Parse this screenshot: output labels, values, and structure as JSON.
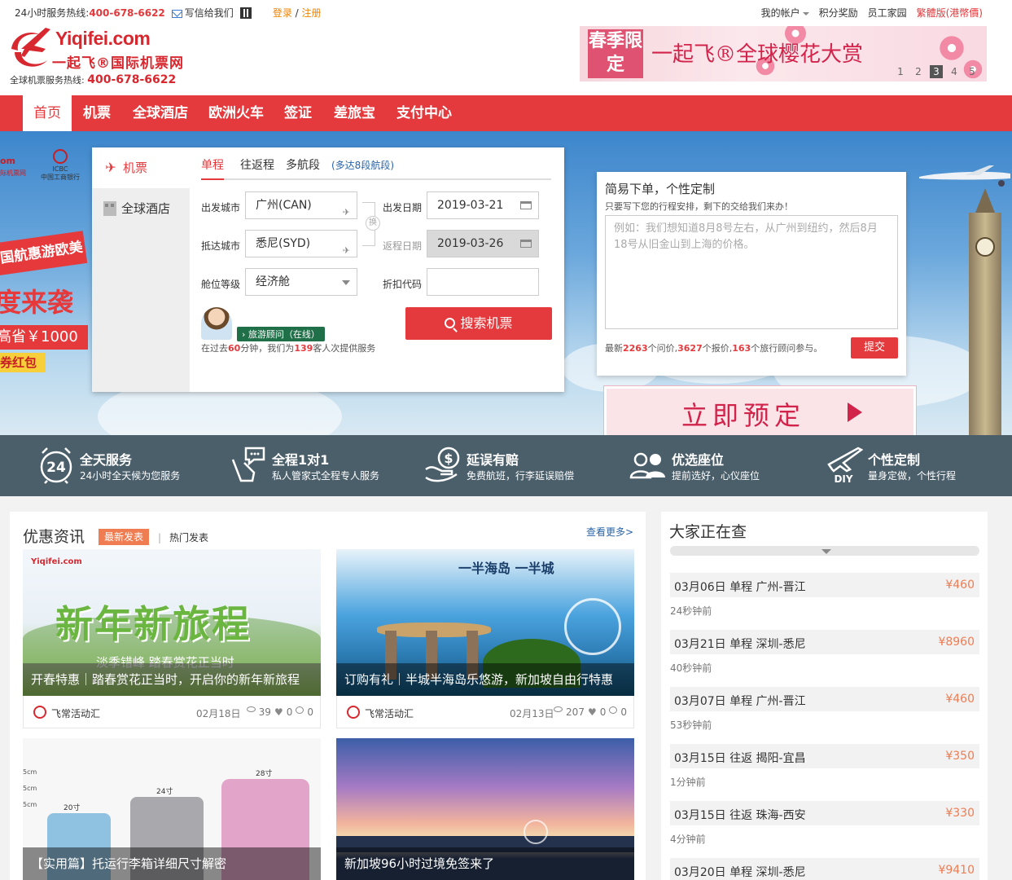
{
  "topbar": {
    "hotline_label": "24小时服务热线:",
    "hotline": "400-678-6622",
    "mail": "写信给我们",
    "login": "登录",
    "sep": "/",
    "register": "注册",
    "account": "我的帐户",
    "points": "积分奖励",
    "staff": "员工家园",
    "traditional": "繁體版(港幣價)"
  },
  "logo": {
    "name": "Yiqifei.com",
    "cn": "一起飞®国际机票网",
    "hotline_label": "全球机票服务热线:",
    "hotline": "400-678-6622"
  },
  "top_banner": {
    "tag": "春季限定",
    "slogan": "一起飞®全球樱花大赏",
    "pages": [
      "1",
      "2",
      "3",
      "4",
      "5"
    ],
    "active_page": "3"
  },
  "nav": [
    "首页",
    "机票",
    "全球酒店",
    "欧洲火车",
    "签证",
    "差旅宝",
    "支付中心"
  ],
  "promo_left": {
    "bank": "中国工商银行",
    "bank_abbr": "ICBC",
    "brand_fragment": "om",
    "brand_sub": "际机票网",
    "ribbon": "国航惠游欧美",
    "big": "度来袭",
    "save": "高省￥1000",
    "pack": "券红包"
  },
  "search": {
    "tabs": [
      "机票",
      "全球酒店"
    ],
    "trip_types": [
      "单程",
      "往返程",
      "多航段"
    ],
    "multi_note": "(多达8段航段)",
    "labels": {
      "from": "出发城市",
      "to": "抵达城市",
      "cabin": "舱位等级",
      "depart": "出发日期",
      "return": "返程日期",
      "discount": "折扣代码"
    },
    "values": {
      "from": "广州(CAN)",
      "to": "悉尼(SYD)",
      "cabin": "经济舱",
      "depart": "2019-03-21",
      "return": "2019-03-26",
      "discount": ""
    },
    "swap": "换",
    "button": "搜索机票",
    "advisor_tag": "旅游顾问（在线）",
    "advisor_line_pre": "在过去",
    "advisor_minutes": "60",
    "advisor_line_mid": "分钟，我们为",
    "advisor_count": "139",
    "advisor_line_post": "客人次提供服务"
  },
  "quick_order": {
    "title": "简易下单，个性定制",
    "subtitle": "只要写下您的行程安排，剩下的交给我们来办！",
    "placeholder": "例如：我们想知道8月8号左右，从广州到纽约，然后8月18号从旧金山到上海的价格。",
    "stats_pre": "最新",
    "questions": "2263",
    "stats_q": "个问价,",
    "quotes": "3627",
    "stats_p": "个报价,",
    "advisors": "163",
    "stats_a": "个旅行顾问参与。",
    "submit": "提交"
  },
  "book_now": "立即预定",
  "features": [
    {
      "title": "全天服务",
      "sub": "24小时全天候为您服务",
      "icon": "alarm-clock-24-icon"
    },
    {
      "title": "全程1对1",
      "sub": "私人管家式全程专人服务",
      "icon": "chat-hand-icon"
    },
    {
      "title": "延误有赔",
      "sub": "免费航班，行李延误赔偿",
      "icon": "money-bag-icon"
    },
    {
      "title": "优选座位",
      "sub": "提前选好，心仪座位",
      "icon": "users-icon"
    },
    {
      "title": "个性定制",
      "sub": "量身定做，个性行程",
      "icon": "plane-diy-icon"
    }
  ],
  "news": {
    "title": "优惠资讯",
    "latest": "最新发表",
    "hot": "热门发表",
    "more": "查看更多>",
    "cards": [
      {
        "image_text": "新年新旅程",
        "image_sub": "淡季错峰 踏春赏花正当时",
        "caption": "开春特惠｜踏春赏花正当时，开启你的新年新旅程",
        "source": "飞常活动汇",
        "date": "02月18日",
        "views": "39",
        "likes": "0",
        "comments": "0"
      },
      {
        "image_text": "一半海岛 一半城",
        "caption": "订购有礼｜半城半海岛乐悠游，新加坡自由行特惠",
        "source": "飞常活动汇",
        "date": "02月13日",
        "views": "207",
        "likes": "0",
        "comments": "0"
      },
      {
        "sizes": [
          "20寸",
          "24寸",
          "28寸"
        ],
        "scale": [
          "5cm",
          "5cm",
          "5cm"
        ],
        "caption": "【实用篇】托运行李箱详细尺寸解密"
      },
      {
        "caption": "新加坡96小时过境免签来了"
      }
    ]
  },
  "queries": {
    "title": "大家正在查",
    "rows": [
      {
        "text": "03月06日  单程  广州-晋江",
        "price": "¥460",
        "ago": "24秒钟前"
      },
      {
        "text": "03月21日  单程  深圳-悉尼",
        "price": "¥8960",
        "ago": "40秒钟前"
      },
      {
        "text": "03月07日  单程  广州-晋江",
        "price": "¥460",
        "ago": "53秒钟前"
      },
      {
        "text": "03月15日  往返  揭阳-宜昌",
        "price": "¥350",
        "ago": "1分钟前"
      },
      {
        "text": "03月15日  往返  珠海-西安",
        "price": "¥330",
        "ago": "4分钟前"
      },
      {
        "text": "03月20日  单程  深圳-悉尼",
        "price": "¥9410",
        "ago": ""
      }
    ]
  },
  "colors": {
    "brand_red": "#e43a3d",
    "accent_orange": "#f07c52",
    "feature_bar": "#4b5f6b"
  }
}
